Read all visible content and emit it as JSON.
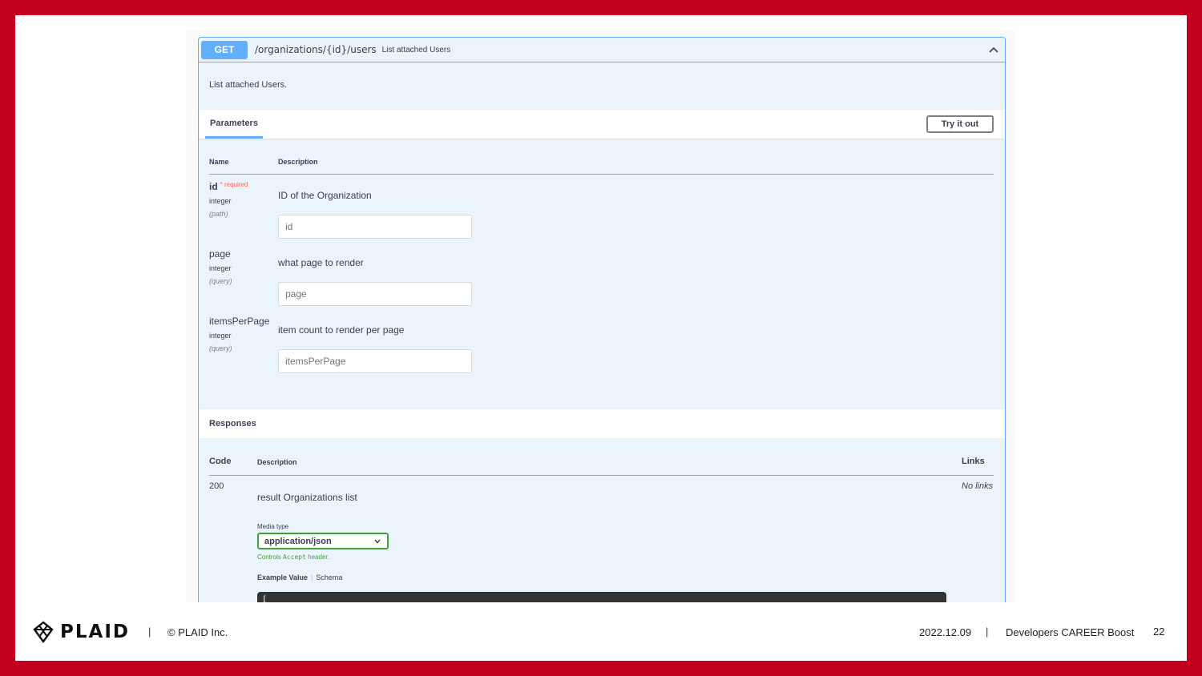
{
  "operation": {
    "method": "GET",
    "path": "/organizations/{id}/users",
    "summary": "List attached Users",
    "description": "List attached Users."
  },
  "parameters_section": {
    "tab_label": "Parameters",
    "try_button": "Try it out",
    "col_name": "Name",
    "col_description": "Description",
    "required_label": "* required",
    "items": [
      {
        "name": "id",
        "type": "integer",
        "location": "(path)",
        "description": "ID of the Organization",
        "placeholder": "id",
        "required": true
      },
      {
        "name": "page",
        "type": "integer",
        "location": "(query)",
        "description": "what page to render",
        "placeholder": "page",
        "required": false
      },
      {
        "name": "itemsPerPage",
        "type": "integer",
        "location": "(query)",
        "description": "item count to render per page",
        "placeholder": "itemsPerPage",
        "required": false
      }
    ]
  },
  "responses_section": {
    "title": "Responses",
    "col_code": "Code",
    "col_description": "Description",
    "col_links": "Links",
    "rows": [
      {
        "code": "200",
        "description": "result Organizations list",
        "links": "No links"
      }
    ],
    "media_type_label": "Media type",
    "media_type_value": "application/json",
    "controls_prefix": "Controls ",
    "controls_code": "Accept",
    "controls_suffix": " header.",
    "example_value_tab": "Example Value",
    "schema_tab": "Schema",
    "code_preview": "["
  },
  "footer": {
    "logo_text": "PLAID",
    "copyright": "© PLAID Inc.",
    "date": "2022.12.09",
    "event": "Developers CAREER Boost",
    "page_number": "22"
  },
  "colors": {
    "frame": "#c4001f",
    "get_accent": "#61affe",
    "media_border": "#41a336"
  }
}
